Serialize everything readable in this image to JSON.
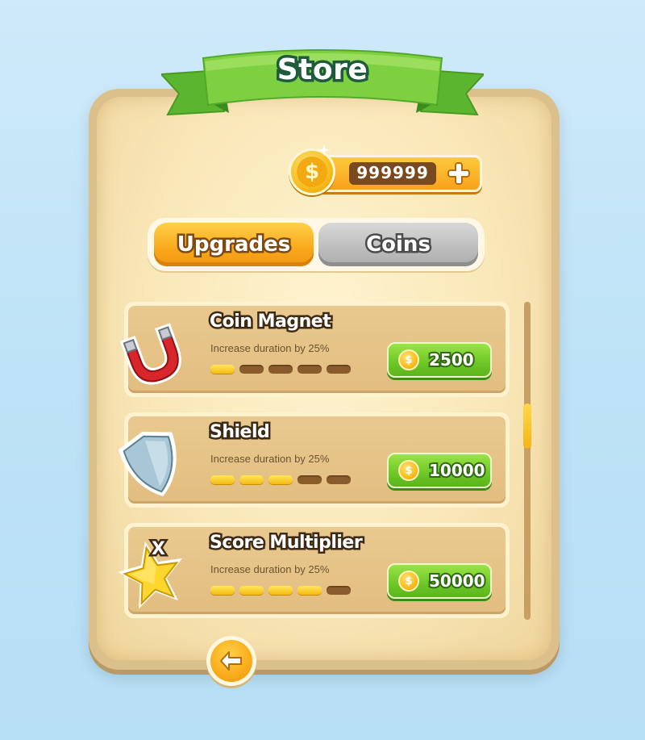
{
  "store": {
    "title": "Store",
    "balance": "999999",
    "plus_icon": "plus-icon"
  },
  "tabs": [
    {
      "label": "Upgrades",
      "active": true
    },
    {
      "label": "Coins",
      "active": false
    }
  ],
  "items": [
    {
      "name": "Coin Magnet",
      "description": "Increase duration by 25%",
      "price": "2500",
      "level": 1,
      "max_level": 5,
      "icon": "magnet-icon"
    },
    {
      "name": "Shield",
      "description": "Increase duration by 25%",
      "price": "10000",
      "level": 3,
      "max_level": 5,
      "icon": "shield-icon"
    },
    {
      "name": "Score Multiplier",
      "description": "Increase duration by 25%",
      "price": "50000",
      "level": 4,
      "max_level": 5,
      "icon": "star-multiplier-icon",
      "icon_text": "X"
    }
  ],
  "colors": {
    "accent_orange": "#f9a81b",
    "buy_green": "#6dc726",
    "ribbon_green": "#7fd040",
    "panel": "#f9e7b8"
  },
  "scroll": {
    "position": 0.35
  },
  "back_icon": "arrow-left-icon"
}
